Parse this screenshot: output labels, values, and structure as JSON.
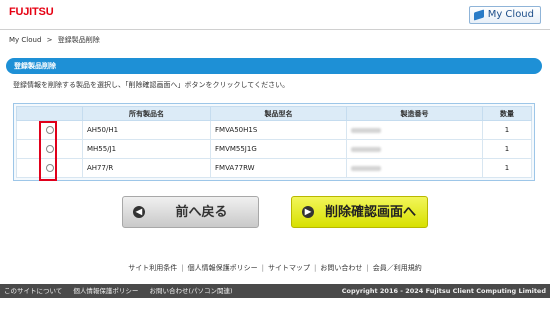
{
  "header": {
    "logo": "FUJITSU",
    "my_cloud": "My Cloud"
  },
  "breadcrumb": {
    "home": "My Cloud",
    "separator": ">",
    "current": "登録製品削除"
  },
  "section": {
    "title": "登録製品削除"
  },
  "instruction": "登録情報を削除する製品を選択し、「削除確認画面へ」ボタンをクリックしてください。",
  "table": {
    "headers": [
      "",
      "所有製品名",
      "製品型名",
      "製造番号",
      "数量"
    ],
    "rows": [
      {
        "name": "AH50/H1",
        "model": "FMVA50H1S",
        "qty": "1"
      },
      {
        "name": "MH55/J1",
        "model": "FMVM55J1G",
        "qty": "1"
      },
      {
        "name": "AH77/R",
        "model": "FMVA77RW",
        "qty": "1"
      }
    ]
  },
  "buttons": {
    "back": "前へ戻る",
    "next": "削除確認画面へ"
  },
  "footer_links": [
    "サイト利用条件",
    "個人情報保護ポリシー",
    "サイトマップ",
    "お問い合わせ",
    "会員／利用規約"
  ],
  "footer_bar": {
    "left": [
      "このサイトについて",
      "個人情報保護ポリシー",
      "お問い合わせ(パソコン関連)"
    ],
    "copyright": "Copyright 2016 - 2024 Fujitsu Client Computing Limited"
  },
  "colors": {
    "accent": "#1e90d6",
    "brand": "#e60012",
    "highlight": "#e0001b",
    "next_button": "#d8e000"
  }
}
